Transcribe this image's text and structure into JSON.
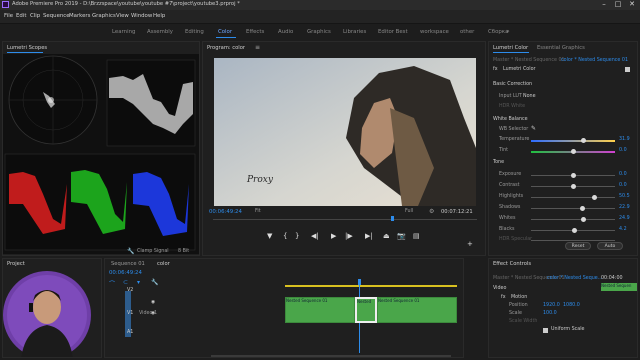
{
  "window": {
    "title": "Adobe Premiere Pro 2019 - D:\\Brzzspace\\youtube\\youtube #7\\project\\youtube3.prproj *",
    "controls": [
      "–",
      "□",
      "✕"
    ]
  },
  "menu": [
    "File",
    "Edit",
    "Clip",
    "Sequence",
    "Markers",
    "Graphics",
    "View",
    "Window",
    "Help"
  ],
  "workspaces": [
    "Learning",
    "Assembly",
    "Editing",
    "Color",
    "Effects",
    "Audio",
    "Graphics",
    "Libraries",
    "Editor Best",
    "workspace",
    "other",
    "Сборка"
  ],
  "workspace_active": "Color",
  "lumetri_scopes": {
    "title": "Lumetri Scopes",
    "clamp_label": "Clamp Signal",
    "bit_depth": "8 Bit"
  },
  "program_monitor": {
    "title": "Program: color",
    "proxy_text": "Proxy",
    "timecode_current": "00:06:49:24",
    "fit": "Fit",
    "resolution": "Full",
    "timecode_duration": "00:07:12:21"
  },
  "lumetri_color": {
    "tab_active": "Lumetri Color",
    "tab_other": "Essential Graphics",
    "source_left": "Master * Nested Sequence 01",
    "source_right": "color * Nested Sequence 01",
    "fx_label": "Lumetri Color",
    "basic_correction": "Basic Correction",
    "input_lut_label": "Input LUT",
    "input_lut_value": "None",
    "hdr_white_label": "HDR White",
    "white_balance": "White Balance",
    "wb_selector": "WB Selector",
    "tone": "Tone",
    "sliders": [
      {
        "name": "Temperature",
        "value": "31.9",
        "pos": 0.62
      },
      {
        "name": "Tint",
        "value": "0.0",
        "pos": 0.5
      },
      {
        "name": "Exposure",
        "value": "0.0",
        "pos": 0.5
      },
      {
        "name": "Contrast",
        "value": "0.0",
        "pos": 0.5
      },
      {
        "name": "Highlights",
        "value": "50.5",
        "pos": 0.75
      },
      {
        "name": "Shadows",
        "value": "22.9",
        "pos": 0.61
      },
      {
        "name": "Whites",
        "value": "24.9",
        "pos": 0.62
      },
      {
        "name": "Blacks",
        "value": "4.2",
        "pos": 0.52
      },
      {
        "name": "HDR Specular",
        "value": "",
        "pos": 0.5
      }
    ],
    "reset_label": "Reset",
    "auto_label": "Auto"
  },
  "project_panel": {
    "tab": "Project"
  },
  "timeline": {
    "tabs": [
      "Sequence 01",
      "color"
    ],
    "timecode": "00:06:49:24",
    "tracks": [
      {
        "id": "V2",
        "label": ""
      },
      {
        "id": "V1",
        "label": "Video 1"
      },
      {
        "id": "A1",
        "label": ""
      }
    ],
    "clips": [
      "Nested Sequence 01",
      "Nested",
      "Nested Sequence 01"
    ]
  },
  "effect_controls": {
    "title": "Effect Controls",
    "source_left": "Master * Nested Sequence 01",
    "source_right": "color * Nested Seque...",
    "timecode": "00:04:00",
    "section": "Video",
    "motion": "Motion",
    "position_label": "Position",
    "position_x": "1920.0",
    "position_y": "1080.0",
    "scale_label": "Scale",
    "scale_value": "100.0",
    "scale_width_label": "Scale Width",
    "uniform_scale": "Uniform Scale",
    "clip_label": "Nested Sequen"
  },
  "colors": {
    "accent": "#2d8ceb",
    "clip_green": "#4aa64a",
    "panel_bg": "#1f1f1f"
  }
}
